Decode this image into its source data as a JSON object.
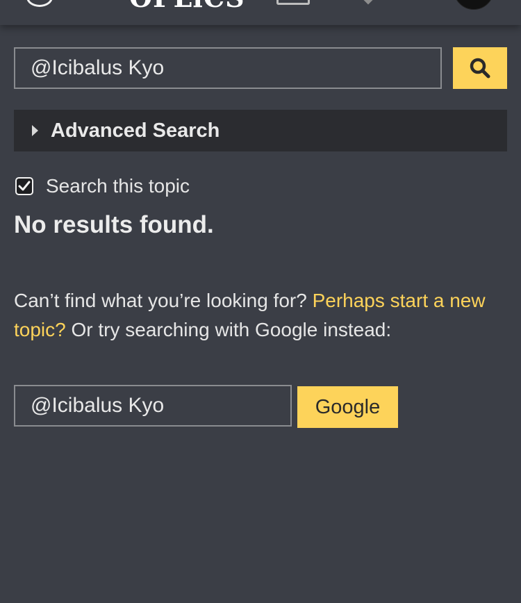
{
  "header": {
    "logo_text": "OPLiCS",
    "icons": [
      "menu-circle-icon",
      "hamburger-icon",
      "chat-icon",
      "pin-icon",
      "user-avatar"
    ]
  },
  "search": {
    "query": "@Icibalus Kyo",
    "button_icon": "search-icon"
  },
  "advanced": {
    "label": "Advanced Search",
    "icon": "caret-right-icon"
  },
  "topic_filter": {
    "label": "Search this topic",
    "checked": true
  },
  "results": {
    "message": "No results found."
  },
  "help": {
    "prefix": "Can’t find what you’re looking for?",
    "link": "Perhaps start a new topic?",
    "suffix": "Or try searching with Google instead:"
  },
  "google": {
    "query": "@Icibalus Kyo",
    "button_label": "Google"
  },
  "colors": {
    "background": "#3b3e46",
    "accent": "#fdd35a",
    "bar": "#2b2c30",
    "text": "#e9e9e9",
    "logo_accent": "#3a9be0"
  }
}
